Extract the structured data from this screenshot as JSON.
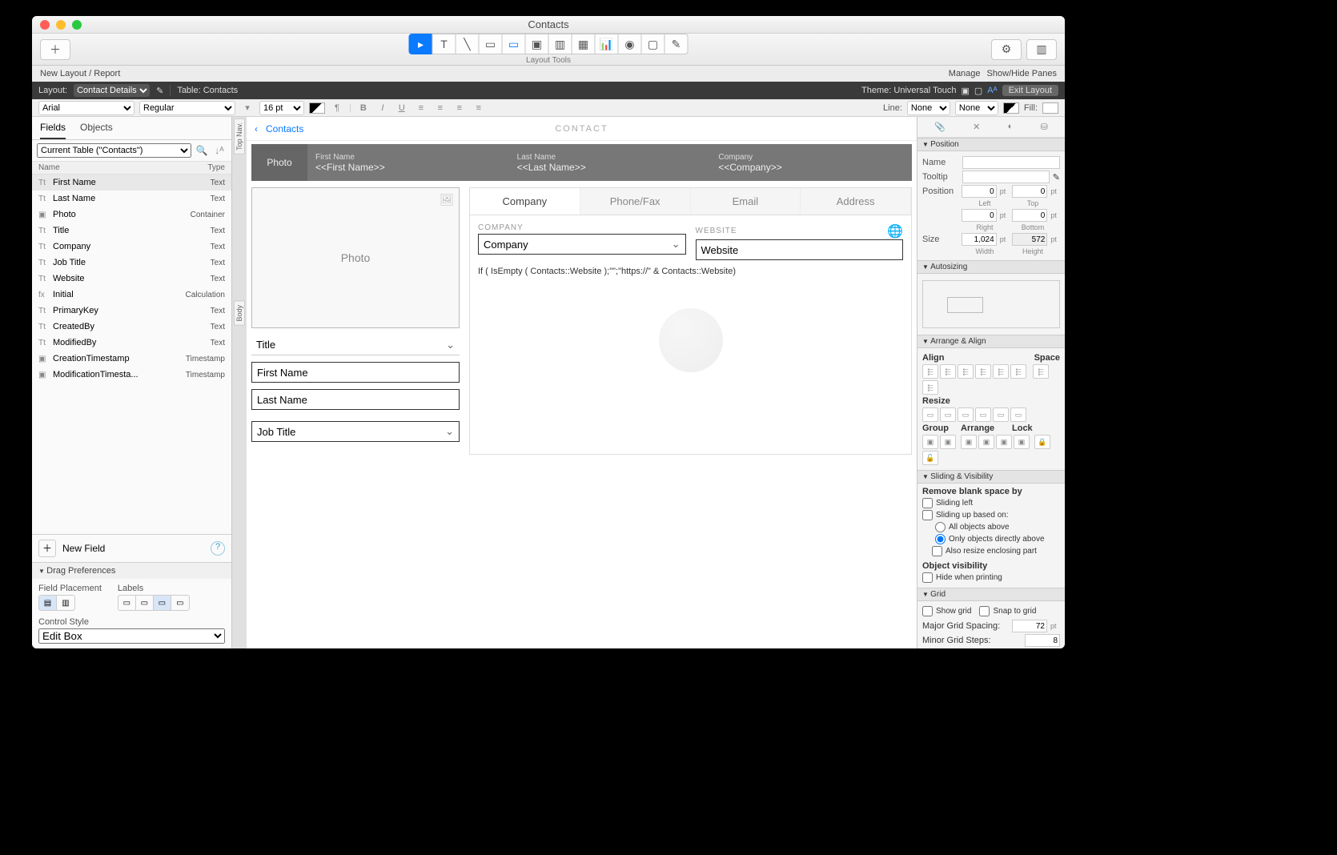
{
  "window_title": "Contacts",
  "toolbar": {
    "layout_tools_label": "Layout Tools",
    "new_layout": "New Layout / Report",
    "manage": "Manage",
    "show_hide": "Show/Hide Panes"
  },
  "darkbar": {
    "layout_label": "Layout:",
    "layout_value": "Contact Details",
    "table_label": "Table: Contacts",
    "theme": "Theme: Universal Touch",
    "exit": "Exit Layout"
  },
  "fmtbar": {
    "font": "Arial",
    "weight": "Regular",
    "size": "16 pt",
    "line_label": "Line:",
    "line_none1": "None",
    "line_none2": "None",
    "fill_label": "Fill:"
  },
  "lpanel": {
    "tab_fields": "Fields",
    "tab_objects": "Objects",
    "table_selector": "Current Table (\"Contacts\")",
    "col_name": "Name",
    "col_type": "Type",
    "fields": [
      {
        "name": "First Name",
        "type": "Text",
        "icon": "Tt",
        "sel": true
      },
      {
        "name": "Last Name",
        "type": "Text",
        "icon": "Tt"
      },
      {
        "name": "Photo",
        "type": "Container",
        "icon": "▣"
      },
      {
        "name": "Title",
        "type": "Text",
        "icon": "Tt"
      },
      {
        "name": "Company",
        "type": "Text",
        "icon": "Tt"
      },
      {
        "name": "Job Title",
        "type": "Text",
        "icon": "Tt"
      },
      {
        "name": "Website",
        "type": "Text",
        "icon": "Tt"
      },
      {
        "name": "Initial",
        "type": "Calculation",
        "icon": "fx"
      },
      {
        "name": "PrimaryKey",
        "type": "Text",
        "icon": "Tt"
      },
      {
        "name": "CreatedBy",
        "type": "Text",
        "icon": "Tt"
      },
      {
        "name": "ModifiedBy",
        "type": "Text",
        "icon": "Tt"
      },
      {
        "name": "CreationTimestamp",
        "type": "Timestamp",
        "icon": "▣"
      },
      {
        "name": "ModificationTimesta...",
        "type": "Timestamp",
        "icon": "▣"
      }
    ],
    "new_field": "New Field",
    "drag_prefs": "Drag Preferences",
    "field_placement": "Field Placement",
    "labels": "Labels",
    "control_style": "Control Style",
    "control_value": "Edit Box"
  },
  "canvas": {
    "part_top": "Top Nav.",
    "part_body": "Body",
    "back": "Contacts",
    "title": "CONTACT",
    "photo_label": "Photo",
    "header_cols": [
      {
        "label": "First Name",
        "merge": "<<First Name>>"
      },
      {
        "label": "Last Name",
        "merge": "<<Last Name>>"
      },
      {
        "label": "Company",
        "merge": "<<Company>>"
      }
    ],
    "photo_placeholder": "Photo",
    "tabs": [
      "Company",
      "Phone/Fax",
      "Email",
      "Address"
    ],
    "company_label": "COMPANY",
    "website_label": "WEBSITE",
    "company_field": "Company",
    "website_field": "Website",
    "calc": "If ( IsEmpty ( Contacts::Website );\"\";\"https://\" & Contacts::Website)",
    "title_field": "Title",
    "first_name_field": "First Name",
    "last_name_field": "Last Name",
    "job_title_field": "Job Title"
  },
  "inspector": {
    "position_h": "Position",
    "name_l": "Name",
    "tooltip_l": "Tooltip",
    "position_l": "Position",
    "pos_left": "0",
    "pos_top": "0",
    "left": "Left",
    "top": "Top",
    "pos_right": "0",
    "pos_bottom": "0",
    "right": "Right",
    "bottom": "Bottom",
    "size_l": "Size",
    "size_w": "1,024",
    "size_h": "572",
    "width": "Width",
    "height": "Height",
    "autosizing_h": "Autosizing",
    "arrange_h": "Arrange & Align",
    "align_l": "Align",
    "space_l": "Space",
    "resize_l": "Resize",
    "group_l": "Group",
    "arrange_l": "Arrange",
    "lock_l": "Lock",
    "sliding_h": "Sliding & Visibility",
    "remove_blank": "Remove blank space by",
    "sliding_left": "Sliding left",
    "sliding_up": "Sliding up based on:",
    "all_above": "All objects above",
    "only_above": "Only objects directly above",
    "also_resize": "Also resize enclosing part",
    "obj_vis": "Object visibility",
    "hide_print": "Hide when printing",
    "grid_h": "Grid",
    "show_grid": "Show grid",
    "snap_grid": "Snap to grid",
    "major_spacing_l": "Major Grid Spacing:",
    "major_spacing": "72",
    "minor_steps_l": "Minor Grid Steps:",
    "minor_steps": "8"
  }
}
